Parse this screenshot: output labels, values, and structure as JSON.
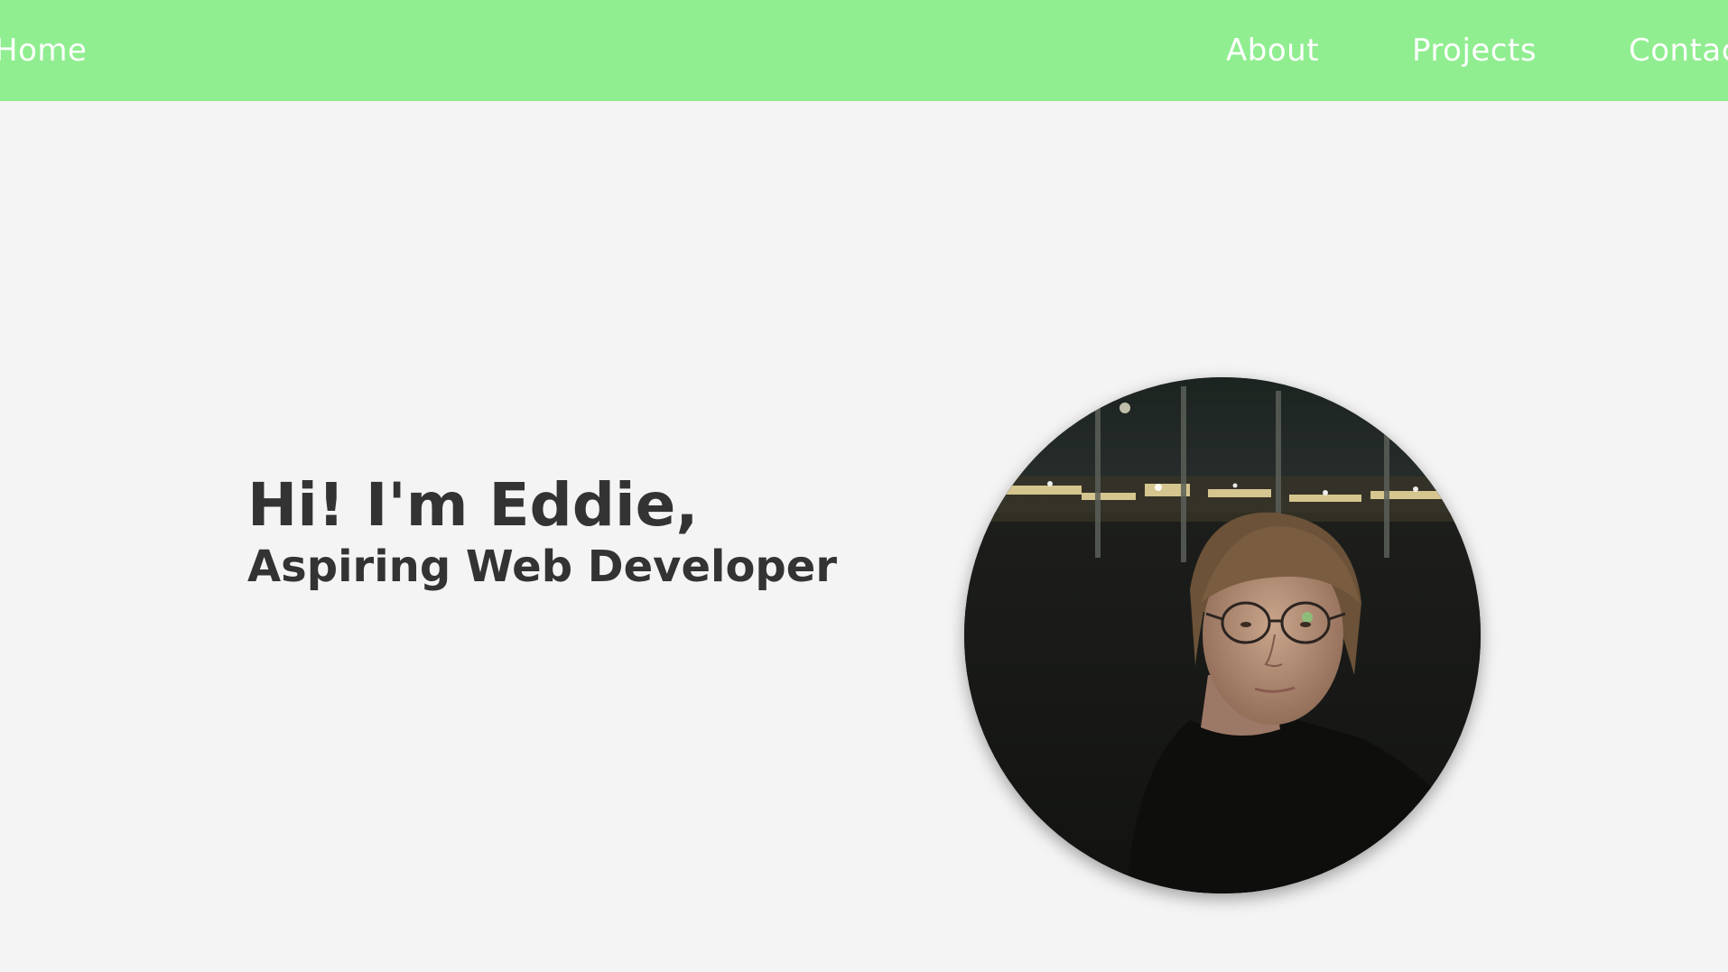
{
  "nav": {
    "items": [
      {
        "label": "Home"
      },
      {
        "label": "About"
      },
      {
        "label": "Projects"
      },
      {
        "label": "Contact"
      }
    ]
  },
  "hero": {
    "greeting": "Hi! I'm Eddie,",
    "subtitle": "Aspiring Web Developer"
  },
  "colors": {
    "nav_background": "#90ee90",
    "nav_text": "#ffffff",
    "page_background": "#f4f4f4",
    "heading_text": "#333333"
  }
}
